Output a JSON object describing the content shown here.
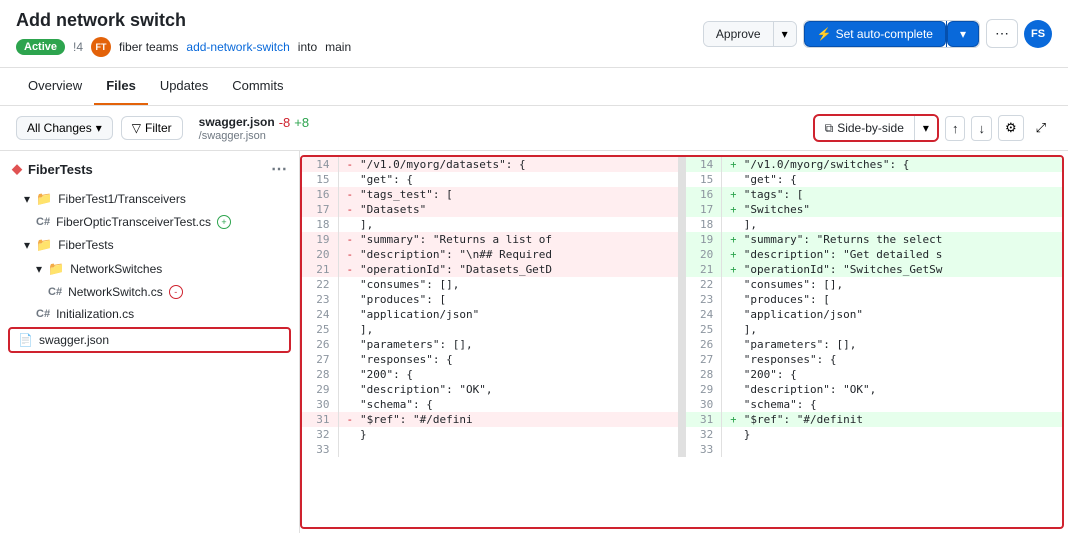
{
  "header": {
    "title": "Add network switch",
    "badge": "Active",
    "pr_number": "!4",
    "author_initials": "FT",
    "author_name": "fiber teams",
    "branch_from": "add-network-switch",
    "branch_to": "main",
    "btn_approve": "Approve",
    "btn_autocomplete": "Set auto-complete",
    "user_initials": "FS"
  },
  "nav_tabs": [
    {
      "label": "Overview",
      "active": false
    },
    {
      "label": "Files",
      "active": true
    },
    {
      "label": "Updates",
      "active": false
    },
    {
      "label": "Commits",
      "active": false
    }
  ],
  "toolbar": {
    "all_changes_label": "All Changes",
    "filter_label": "Filter",
    "file_name": "swagger.json",
    "del_count": "-8",
    "add_count": "+8",
    "file_path": "/swagger.json",
    "side_by_side_label": "Side-by-side",
    "up_arrow": "↑",
    "down_arrow": "↓"
  },
  "sidebar": {
    "title": "FiberTests",
    "items": [
      {
        "label": "FiberTest1/Transceivers",
        "type": "folder",
        "indent": 1
      },
      {
        "label": "FiberOpticTransceiverTest.cs",
        "type": "csharp",
        "indent": 2,
        "badge": "+"
      },
      {
        "label": "FiberTests",
        "type": "folder",
        "indent": 1
      },
      {
        "label": "NetworkSwitches",
        "type": "folder",
        "indent": 2
      },
      {
        "label": "NetworkSwitch.cs",
        "type": "csharp",
        "indent": 3,
        "badge": "-"
      },
      {
        "label": "Initialization.cs",
        "type": "csharp",
        "indent": 2
      },
      {
        "label": "swagger.json",
        "type": "file",
        "indent": 1,
        "selected": true
      }
    ]
  },
  "diff": {
    "left_lines": [
      {
        "num": "14",
        "type": "del",
        "code": "    \"/v1.0/myorg/datasets\": {"
      },
      {
        "num": "15",
        "type": "normal",
        "code": "        \"get\": {"
      },
      {
        "num": "16",
        "type": "del",
        "code": "            \"tags_test\": ["
      },
      {
        "num": "17",
        "type": "del",
        "code": "                \"Datasets\""
      },
      {
        "num": "18",
        "type": "normal",
        "code": "            ],"
      },
      {
        "num": "19",
        "type": "del",
        "code": "            \"summary\": \"Returns a list of"
      },
      {
        "num": "20",
        "type": "del",
        "code": "            \"description\": \"\\n## Required"
      },
      {
        "num": "21",
        "type": "del",
        "code": "            \"operationId\": \"Datasets_GetD"
      },
      {
        "num": "22",
        "type": "normal",
        "code": "            \"consumes\": [],"
      },
      {
        "num": "23",
        "type": "normal",
        "code": "            \"produces\": ["
      },
      {
        "num": "24",
        "type": "normal",
        "code": "                \"application/json\""
      },
      {
        "num": "25",
        "type": "normal",
        "code": "            ],"
      },
      {
        "num": "26",
        "type": "normal",
        "code": "            \"parameters\": [],"
      },
      {
        "num": "27",
        "type": "normal",
        "code": "            \"responses\": {"
      },
      {
        "num": "28",
        "type": "normal",
        "code": "                \"200\": {"
      },
      {
        "num": "29",
        "type": "normal",
        "code": "                    \"description\": \"OK\","
      },
      {
        "num": "30",
        "type": "normal",
        "code": "                    \"schema\": {"
      },
      {
        "num": "31",
        "type": "del",
        "code": "                        \"$ref\": \"#/defini"
      },
      {
        "num": "32",
        "type": "normal",
        "code": "                    }"
      },
      {
        "num": "33",
        "type": "normal",
        "code": ""
      }
    ],
    "right_lines": [
      {
        "num": "14",
        "type": "add",
        "code": "    \"/v1.0/myorg/switches\": {"
      },
      {
        "num": "15",
        "type": "normal",
        "code": "        \"get\": {"
      },
      {
        "num": "16",
        "type": "add",
        "code": "            \"tags\": ["
      },
      {
        "num": "17",
        "type": "add",
        "code": "                \"Switches\""
      },
      {
        "num": "18",
        "type": "normal",
        "code": "            ],"
      },
      {
        "num": "19",
        "type": "add",
        "code": "            \"summary\": \"Returns the select"
      },
      {
        "num": "20",
        "type": "add",
        "code": "            \"description\": \"Get detailed s"
      },
      {
        "num": "21",
        "type": "add",
        "code": "            \"operationId\": \"Switches_GetSw"
      },
      {
        "num": "22",
        "type": "normal",
        "code": "            \"consumes\": [],"
      },
      {
        "num": "23",
        "type": "normal",
        "code": "            \"produces\": ["
      },
      {
        "num": "24",
        "type": "normal",
        "code": "                \"application/json\""
      },
      {
        "num": "25",
        "type": "normal",
        "code": "            ],"
      },
      {
        "num": "26",
        "type": "normal",
        "code": "            \"parameters\": [],"
      },
      {
        "num": "27",
        "type": "normal",
        "code": "            \"responses\": {"
      },
      {
        "num": "28",
        "type": "normal",
        "code": "                \"200\": {"
      },
      {
        "num": "29",
        "type": "normal",
        "code": "                    \"description\": \"OK\","
      },
      {
        "num": "30",
        "type": "normal",
        "code": "                    \"schema\": {"
      },
      {
        "num": "31",
        "type": "add",
        "code": "                        \"$ref\": \"#/definit"
      },
      {
        "num": "32",
        "type": "normal",
        "code": "                    }"
      },
      {
        "num": "33",
        "type": "normal",
        "code": ""
      }
    ]
  }
}
